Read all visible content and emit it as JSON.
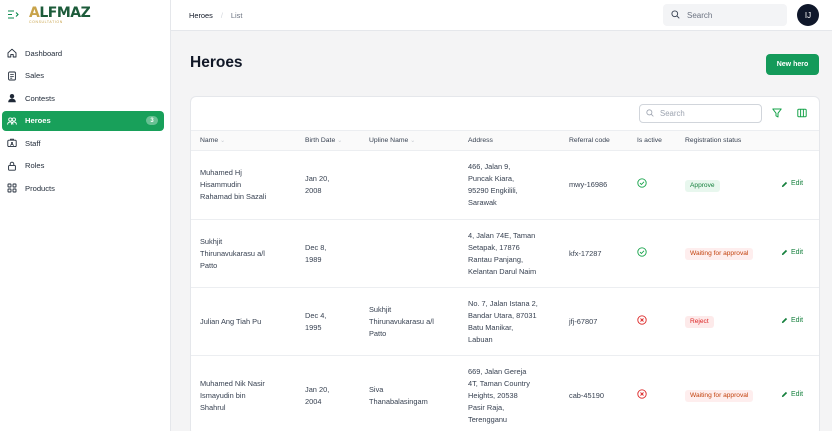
{
  "brand": {
    "logo_main_pre": "A",
    "logo_main_rest": "LFMAZ",
    "logo_sub": "CONSULTATION"
  },
  "sidebar": {
    "items": [
      {
        "label": "Dashboard",
        "icon": "home-icon"
      },
      {
        "label": "Sales",
        "icon": "document-icon"
      },
      {
        "label": "Contests",
        "icon": "user-icon"
      },
      {
        "label": "Heroes",
        "icon": "group-icon",
        "badge": "3",
        "active": true
      },
      {
        "label": "Staff",
        "icon": "id-card-icon"
      },
      {
        "label": "Roles",
        "icon": "lock-icon"
      },
      {
        "label": "Products",
        "icon": "grid-icon"
      }
    ]
  },
  "breadcrumb": {
    "current": "Heroes",
    "separator": "/",
    "page": "List"
  },
  "topbar": {
    "search_placeholder": "Search",
    "avatar_initials": "IJ"
  },
  "page": {
    "title": "Heroes",
    "new_button": "New hero"
  },
  "table": {
    "search_placeholder": "Search",
    "columns": [
      "Name",
      "Birth Date",
      "Upline Name",
      "Address",
      "Referral code",
      "Is active",
      "Registration status"
    ],
    "sortable": [
      true,
      true,
      true,
      false,
      false,
      false,
      false
    ],
    "edit_label": "Edit",
    "rows": [
      {
        "name": [
          "Muhamed Hj",
          "Hisammudin",
          "Rahamad bin Sazali"
        ],
        "birth": [
          "Jan 20,",
          "2008"
        ],
        "upline": [],
        "address": [
          "466, Jalan 9,",
          "Puncak Kiara,",
          "95290 Engkilili,",
          "Sarawak"
        ],
        "referral": "mwy-16986",
        "active": true,
        "status": "Approve",
        "status_kind": "approve"
      },
      {
        "name": [
          "Sukhjit",
          "Thirunavukarasu a/l",
          "Patto"
        ],
        "birth": [
          "Dec 8,",
          "1989"
        ],
        "upline": [],
        "address": [
          "4, Jalan 74E, Taman",
          "Setapak, 17876",
          "Rantau Panjang,",
          "Kelantan Darul Naim"
        ],
        "referral": "kfx-17287",
        "active": true,
        "status": "Waiting for approval",
        "status_kind": "waiting"
      },
      {
        "name": [
          "Julian Ang Tiah Pu"
        ],
        "birth": [
          "Dec 4,",
          "1995"
        ],
        "upline": [
          "Sukhjit",
          "Thirunavukarasu a/l",
          "Patto"
        ],
        "address": [
          "No. 7, Jalan Istana 2,",
          "Bandar Utara, 87031",
          "Batu Manikar,",
          "Labuan"
        ],
        "referral": "jfj-67807",
        "active": false,
        "status": "Reject",
        "status_kind": "reject"
      },
      {
        "name": [
          "Muhamed Nik Nasir",
          "Ismayudin bin",
          "Shahrul"
        ],
        "birth": [
          "Jan 20,",
          "2004"
        ],
        "upline": [
          "Siva",
          "Thanabalasingam"
        ],
        "address": [
          "669, Jalan Gereja",
          "4T, Taman Country",
          "Heights, 20538",
          "Pasir Raja,",
          "Terengganu"
        ],
        "referral": "cab-45190",
        "active": false,
        "status": "Waiting for approval",
        "status_kind": "waiting"
      }
    ]
  },
  "colors": {
    "accent": "#149a5a",
    "active_ok": "#16a34a",
    "inactive": "#dc2626"
  }
}
